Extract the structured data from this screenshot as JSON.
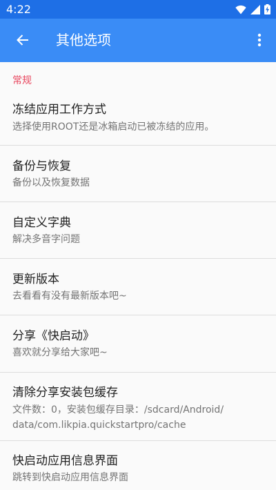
{
  "status_bar": {
    "time": "4:22"
  },
  "app_bar": {
    "title": "其他选项"
  },
  "section": {
    "header": "常规"
  },
  "prefs": [
    {
      "title": "冻结应用工作方式",
      "summary": "选择使用ROOT还是冰箱启动已被冻结的应用。"
    },
    {
      "title": "备份与恢复",
      "summary": "备份以及恢复数据"
    },
    {
      "title": "自定义字典",
      "summary": "解决多音字问题"
    },
    {
      "title": "更新版本",
      "summary": "去看看有没有最新版本吧~"
    },
    {
      "title": "分享《快启动》",
      "summary": "喜欢就分享给大家吧~"
    },
    {
      "title": "清除分享安装包缓存",
      "summary_line1": "文件数：0，安装包缓存目录：/sdcard/Android/",
      "summary_line2": "data/com.likpia.quickstartpro/cache"
    },
    {
      "title": "快启动应用信息界面",
      "summary": "跳转到快启动应用信息界面"
    }
  ],
  "colors": {
    "status_bar": "#1e6fe6",
    "app_bar": "#3a8cf6",
    "section_header": "#e8475f"
  }
}
